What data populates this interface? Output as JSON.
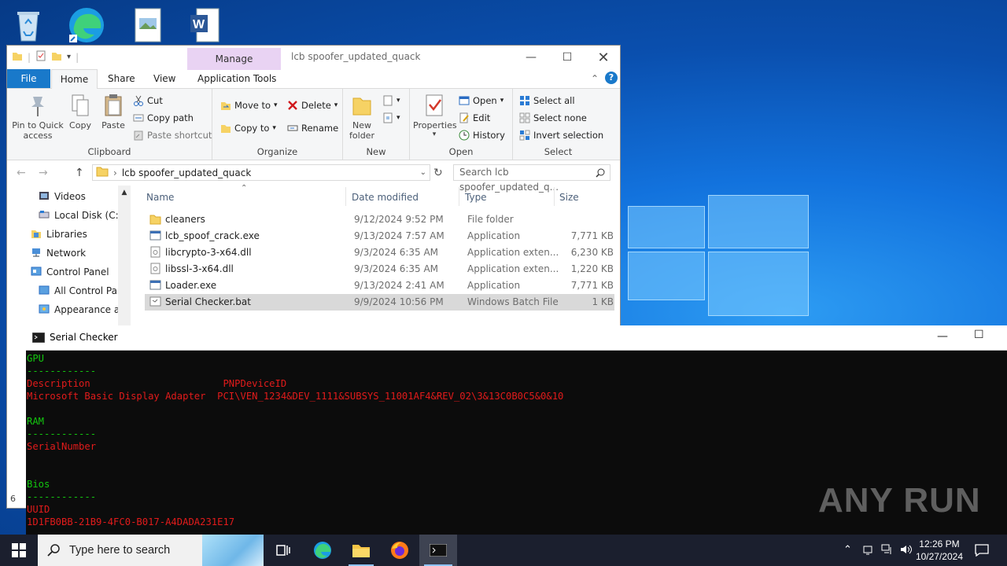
{
  "explorer": {
    "title": "lcb spoofer_updated_quack",
    "manage_tab": "Manage",
    "tabs": [
      "File",
      "Home",
      "Share",
      "View",
      "Application Tools"
    ],
    "clipboard": {
      "pin_label_1": "Pin to Quick",
      "pin_label_2": "access",
      "copy": "Copy",
      "paste": "Paste",
      "cut": "Cut",
      "copy_path": "Copy path",
      "paste_shortcut": "Paste shortcut",
      "group": "Clipboard"
    },
    "organize": {
      "move_to": "Move to",
      "copy_to": "Copy to",
      "delete": "Delete",
      "rename": "Rename",
      "group": "Organize"
    },
    "new": {
      "new_folder_1": "New",
      "new_folder_2": "folder",
      "group": "New"
    },
    "open": {
      "properties": "Properties",
      "open": "Open",
      "edit": "Edit",
      "history": "History",
      "group": "Open"
    },
    "select": {
      "select_all": "Select all",
      "select_none": "Select none",
      "invert": "Invert selection",
      "group": "Select"
    },
    "address": "lcb spoofer_updated_quack",
    "search_placeholder": "Search lcb spoofer_updated_q...",
    "nav_items": [
      "Videos",
      "Local Disk (C:)",
      "Libraries",
      "Network",
      "Control Panel",
      "All Control Par",
      "Appearance an"
    ],
    "columns": {
      "name": "Name",
      "date": "Date modified",
      "type": "Type",
      "size": "Size"
    },
    "files": [
      {
        "name": "cleaners",
        "date": "9/12/2024 9:52 PM",
        "type": "File folder",
        "size": ""
      },
      {
        "name": "lcb_spoof_crack.exe",
        "date": "9/13/2024 7:57 AM",
        "type": "Application",
        "size": "7,771 KB"
      },
      {
        "name": "libcrypto-3-x64.dll",
        "date": "9/3/2024 6:35 AM",
        "type": "Application exten...",
        "size": "6,230 KB"
      },
      {
        "name": "libssl-3-x64.dll",
        "date": "9/3/2024 6:35 AM",
        "type": "Application exten...",
        "size": "1,220 KB"
      },
      {
        "name": "Loader.exe",
        "date": "9/13/2024 2:41 AM",
        "type": "Application",
        "size": "7,771 KB"
      },
      {
        "name": "Serial Checker.bat",
        "date": "9/9/2024 10:56 PM",
        "type": "Windows Batch File",
        "size": "1 KB"
      }
    ],
    "status_count": "6"
  },
  "console": {
    "title": "Serial Checker",
    "lines": [
      {
        "text": "GPU",
        "color": "green"
      },
      {
        "text": "------------",
        "color": "green"
      },
      {
        "text": "Description                       PNPDeviceID",
        "color": "red"
      },
      {
        "text": "Microsoft Basic Display Adapter  PCI\\VEN_1234&DEV_1111&SUBSYS_11001AF4&REV_02\\3&13C0B0C5&0&10",
        "color": "red"
      },
      {
        "text": "",
        "color": "red"
      },
      {
        "text": "RAM",
        "color": "green"
      },
      {
        "text": "------------",
        "color": "green"
      },
      {
        "text": "SerialNumber",
        "color": "red"
      },
      {
        "text": "",
        "color": "red"
      },
      {
        "text": "",
        "color": "red"
      },
      {
        "text": "Bios",
        "color": "green"
      },
      {
        "text": "------------",
        "color": "green"
      },
      {
        "text": "UUID",
        "color": "red"
      },
      {
        "text": "1D1FB0BB-21B9-4FC0-B017-A4DADA231E17",
        "color": "red"
      }
    ]
  },
  "watermark": "ANY RUN",
  "taskbar": {
    "search_placeholder": "Type here to search",
    "time": "12:26 PM",
    "date": "10/27/2024"
  },
  "colors": {
    "accent": "#1979ca",
    "console_green": "#13c70f",
    "console_red": "#e21b1b"
  }
}
